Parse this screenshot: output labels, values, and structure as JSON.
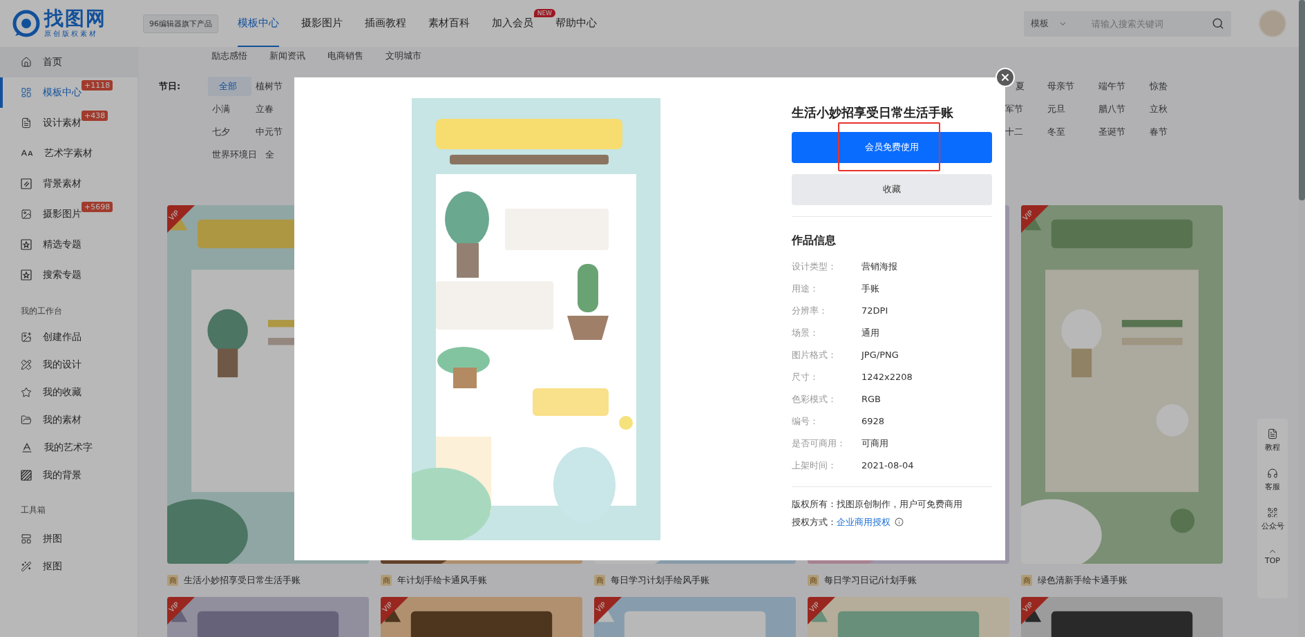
{
  "header": {
    "logo": {
      "name": "找图网",
      "tagline": "原创版权素材"
    },
    "badge": "96编辑器旗下产品",
    "nav": [
      {
        "label": "模板中心",
        "selected": true
      },
      {
        "label": "摄影图片",
        "selected": false
      },
      {
        "label": "插画教程",
        "selected": false
      },
      {
        "label": "素材百科",
        "selected": false
      },
      {
        "label": "加入会员",
        "selected": false,
        "badge": "NEW"
      },
      {
        "label": "帮助中心",
        "selected": false
      }
    ],
    "search": {
      "scope": "模板",
      "placeholder": "请输入搜索关键词"
    }
  },
  "sidebar": {
    "sections": [
      {
        "items": [
          {
            "label": "首页",
            "selected": false,
            "hovered": true
          },
          {
            "label": "模板中心",
            "selected": true,
            "hovered": false,
            "badge": "+1118"
          },
          {
            "label": "设计素材",
            "selected": false,
            "hovered": false,
            "badge": "+438"
          },
          {
            "label": "艺术字素材",
            "selected": false,
            "hovered": false
          },
          {
            "label": "背景素材",
            "selected": false,
            "hovered": false
          },
          {
            "label": "摄影图片",
            "selected": false,
            "hovered": false,
            "badge": "+5698"
          },
          {
            "label": "精选专题",
            "selected": false,
            "hovered": false
          },
          {
            "label": "搜索专题",
            "selected": false,
            "hovered": false
          }
        ]
      },
      {
        "title": "我的工作台",
        "items": [
          {
            "label": "创建作品",
            "selected": false,
            "hovered": false
          },
          {
            "label": "我的设计",
            "selected": false,
            "hovered": false
          },
          {
            "label": "我的收藏",
            "selected": false,
            "hovered": false
          },
          {
            "label": "我的素材",
            "selected": false,
            "hovered": false
          },
          {
            "label": "我的艺术字",
            "selected": false,
            "hovered": false
          },
          {
            "label": "我的背景",
            "selected": false,
            "hovered": false
          }
        ]
      },
      {
        "title": "工具箱",
        "items": [
          {
            "label": "拼图",
            "selected": false,
            "hovered": false
          },
          {
            "label": "抠图",
            "selected": false,
            "hovered": false
          }
        ]
      }
    ]
  },
  "category_tags": [
    "励志感悟",
    "新闻资讯",
    "电商销售",
    "文明城市"
  ],
  "filter": {
    "label": "节日:",
    "left_rows": [
      [
        {
          "label": "全部",
          "selected": true
        },
        {
          "label": "植树节",
          "selected": false
        }
      ],
      [
        {
          "label": "小满",
          "selected": false
        },
        {
          "label": "立春",
          "selected": false
        }
      ],
      [
        {
          "label": "七夕",
          "selected": false
        },
        {
          "label": "中元节",
          "selected": false
        }
      ],
      [
        {
          "label": "世界环境日",
          "selected": false
        },
        {
          "label": "全",
          "selected": false
        }
      ]
    ],
    "right_rows": [
      [
        {
          "label": "夏",
          "selected": false
        },
        {
          "label": "母亲节",
          "selected": false
        },
        {
          "label": "端午节",
          "selected": false
        },
        {
          "label": "惊蛰",
          "selected": false
        }
      ],
      [
        {
          "label": "军节",
          "selected": false
        },
        {
          "label": "元旦",
          "selected": false
        },
        {
          "label": "腊八节",
          "selected": false
        },
        {
          "label": "立秋",
          "selected": false
        }
      ],
      [
        {
          "label": "十二",
          "selected": false
        },
        {
          "label": "冬至",
          "selected": false
        },
        {
          "label": "圣诞节",
          "selected": false
        },
        {
          "label": "春节",
          "selected": false
        }
      ]
    ]
  },
  "cards": [
    {
      "vip": "VIP",
      "license_tag": "商",
      "caption": "生活小妙招享受日常生活手账"
    },
    {
      "license_tag": "商",
      "caption": "年计划手绘卡通风手账"
    },
    {
      "license_tag": "商",
      "caption": "每日学习计划手绘风手账"
    },
    {
      "license_tag": "商",
      "caption": "每日学习日记/计划手账"
    },
    {
      "vip": "VIP",
      "license_tag": "商",
      "caption": "绿色清新手绘卡通手账"
    },
    {
      "vip": "VIP"
    },
    {
      "vip": "VIP"
    },
    {
      "vip": "VIP"
    },
    {
      "vip": "VIP"
    },
    {
      "vip": "VIP"
    }
  ],
  "float_tools": [
    {
      "label": "教程"
    },
    {
      "label": "客服"
    },
    {
      "label": "公众号"
    },
    {
      "label": "TOP"
    }
  ],
  "modal": {
    "title": "生活小妙招享受日常生活手账",
    "primary_button": {
      "label": "会员免费使用",
      "highlighted": true
    },
    "secondary_button": {
      "label": "收藏"
    },
    "info_title": "作品信息",
    "info": [
      {
        "label": "设计类型：",
        "value": "营销海报"
      },
      {
        "label": "用途：",
        "value": "手账"
      },
      {
        "label": "分辨率：",
        "value": "72DPI"
      },
      {
        "label": "场景：",
        "value": "通用"
      },
      {
        "label": "图片格式：",
        "value": "JPG/PNG"
      },
      {
        "label": "尺寸：",
        "value": "1242x2208"
      },
      {
        "label": "色彩模式：",
        "value": "RGB"
      },
      {
        "label": "编号：",
        "value": "6928"
      },
      {
        "label": "是否可商用：",
        "value": "可商用"
      },
      {
        "label": "上架时间：",
        "value": "2021-08-04"
      }
    ],
    "copyright": "版权所有：找图原创制作，用户可免费商用",
    "license": {
      "label": "授权方式：",
      "link": "企业商用授权"
    }
  }
}
